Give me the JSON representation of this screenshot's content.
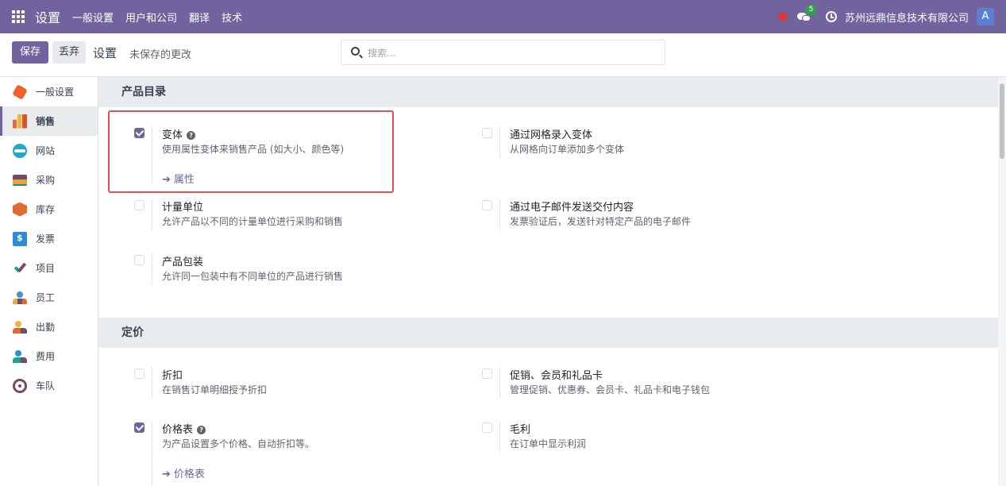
{
  "navbar": {
    "app_title": "设置",
    "menu": [
      "一般设置",
      "用户和公司",
      "翻译",
      "技术"
    ],
    "message_count": "5",
    "company": "苏州远鼎信息技术有限公司",
    "avatar_letter": "A",
    "accent_color": "#71639e"
  },
  "control": {
    "save_label": "保存",
    "discard_label": "丢弃",
    "title": "设置",
    "unsaved": "未保存的更改",
    "search_placeholder": "搜索..."
  },
  "sidebar": {
    "items": [
      {
        "label": "一般设置",
        "icon": "general-settings-icon"
      },
      {
        "label": "销售",
        "icon": "sales-icon"
      },
      {
        "label": "网站",
        "icon": "website-icon"
      },
      {
        "label": "采购",
        "icon": "purchase-icon"
      },
      {
        "label": "库存",
        "icon": "inventory-icon"
      },
      {
        "label": "发票",
        "icon": "invoice-icon"
      },
      {
        "label": "项目",
        "icon": "project-icon"
      },
      {
        "label": "员工",
        "icon": "employee-icon"
      },
      {
        "label": "出勤",
        "icon": "attendance-icon"
      },
      {
        "label": "费用",
        "icon": "expense-icon"
      },
      {
        "label": "车队",
        "icon": "fleet-icon"
      }
    ],
    "active": "销售"
  },
  "catalog": {
    "header": "产品目录",
    "variants": {
      "title": "变体",
      "desc": "使用属性变体来销售产品 (如大小、颜色等)",
      "link": "属性",
      "checked": true
    },
    "grid_variants": {
      "title": "通过网格录入变体",
      "desc": "从网格向订单添加多个变体",
      "checked": false
    },
    "uom": {
      "title": "计量单位",
      "desc": "允许产品以不同的计量单位进行采购和销售",
      "checked": false
    },
    "email_delivery": {
      "title": "通过电子邮件发送交付内容",
      "desc": "发票验证后，发送针对特定产品的电子邮件",
      "checked": false
    },
    "packaging": {
      "title": "产品包装",
      "desc": "允许同一包装中有不同单位的产品进行销售",
      "checked": false
    }
  },
  "pricing": {
    "header": "定价",
    "discount": {
      "title": "折扣",
      "desc": "在销售订单明细授予折扣",
      "checked": false
    },
    "promotions": {
      "title": "促销、会员和礼品卡",
      "desc": "管理促销、优惠券、会员卡、礼品卡和电子钱包",
      "checked": false
    },
    "pricelist": {
      "title": "价格表",
      "desc": "为产品设置多个价格、自动折扣等。",
      "link": "价格表",
      "checked": true
    },
    "margins": {
      "title": "毛利",
      "desc": "在订单中显示利润",
      "checked": false
    }
  }
}
